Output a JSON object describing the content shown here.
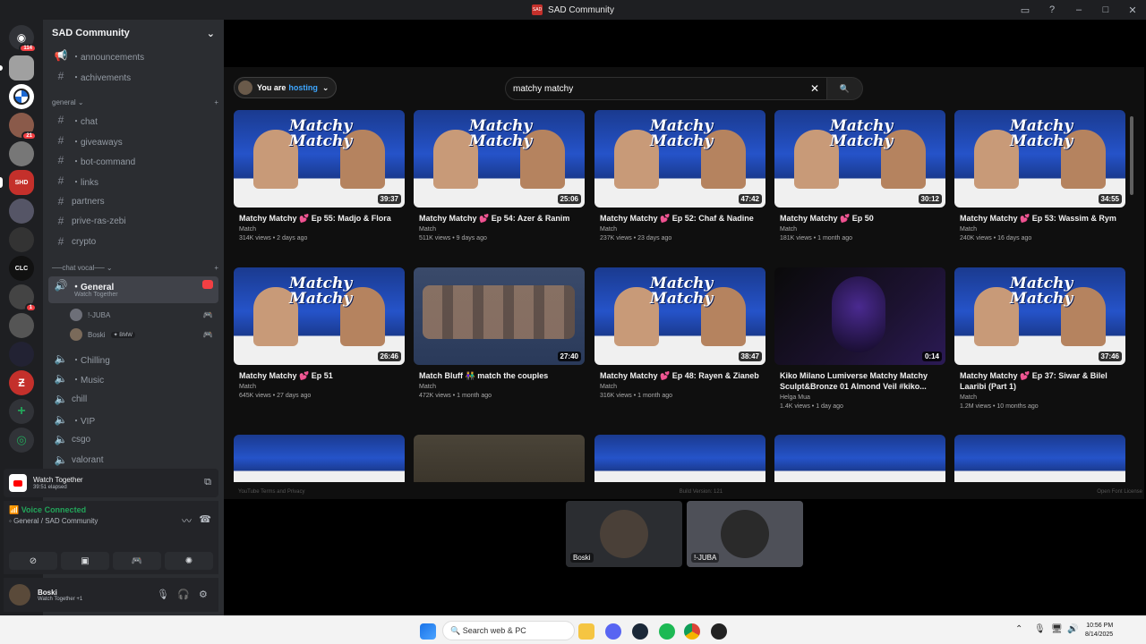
{
  "window": {
    "title": "SAD Community"
  },
  "rail": {
    "badge_top": "114",
    "badges": [
      "21",
      "1"
    ],
    "labels": [
      "SHD",
      "CLC"
    ]
  },
  "server": {
    "name": "SAD Community"
  },
  "channels": {
    "top": [
      {
        "icon": "megaphone-icon",
        "label": "・announcements"
      },
      {
        "icon": "hash-icon",
        "label": "・achivements"
      }
    ],
    "category_general": "general",
    "general": [
      {
        "icon": "hash-icon",
        "label": "・chat"
      },
      {
        "icon": "hash-icon",
        "label": "・giveaways"
      },
      {
        "icon": "hash-icon",
        "label": "・bot-command"
      },
      {
        "icon": "hash-icon",
        "label": "・links"
      },
      {
        "icon": "hash-icon",
        "label": "partners"
      },
      {
        "icon": "hash-icon",
        "label": "prive-ras-zebi"
      },
      {
        "icon": "hash-icon",
        "label": "crypto"
      }
    ],
    "category_voice": "──chat vocal──",
    "voice_active": {
      "label": "・General",
      "sub": "Watch Together"
    },
    "voice_users": [
      {
        "name": "!-JUBA",
        "tag": ""
      },
      {
        "name": "Boski",
        "tag": "BMW"
      }
    ],
    "voice": [
      {
        "label": "・Chilling"
      },
      {
        "label": "・Music"
      },
      {
        "label": "chill"
      },
      {
        "label": "・VIP"
      },
      {
        "label": "csgo"
      },
      {
        "label": "valorant"
      }
    ]
  },
  "activity": {
    "title": "Watch Together",
    "elapsed": "39:51 elapsed"
  },
  "voice_status": {
    "title": "Voice Connected",
    "channel": "General / SAD Community"
  },
  "user": {
    "name": "Boski",
    "status": "Watch Together +1"
  },
  "youtube": {
    "host_prefix": "You are",
    "host_word": "hosting",
    "search_value": "matchy matchy",
    "videos": [
      {
        "title": "Matchy Matchy 💕 Ep 55: Madjo & Flora",
        "channel": "Match",
        "meta": "314K views • 2 days ago",
        "duration": "39:37",
        "style": "studio"
      },
      {
        "title": "Matchy Matchy 💕 Ep 54: Azer & Ranim",
        "channel": "Match",
        "meta": "511K views • 9 days ago",
        "duration": "25:06",
        "style": "studio"
      },
      {
        "title": "Matchy Matchy 💕 Ep 52: Chaf & Nadine",
        "channel": "Match",
        "meta": "237K views • 23 days ago",
        "duration": "47:42",
        "style": "studio"
      },
      {
        "title": "Matchy Matchy 💕 Ep 50",
        "channel": "Match",
        "meta": "181K views • 1 month ago",
        "duration": "30:12",
        "style": "studio"
      },
      {
        "title": "Matchy Matchy 💕 Ep 53: Wassim & Rym",
        "channel": "Match",
        "meta": "240K views • 16 days ago",
        "duration": "34:55",
        "style": "studio"
      },
      {
        "title": "Matchy Matchy 💕 Ep 51",
        "channel": "Match",
        "meta": "645K views • 27 days ago",
        "duration": "26:46",
        "style": "studio"
      },
      {
        "title": "Match Bluff 👫 match the couples",
        "channel": "Match",
        "meta": "472K views • 1 month ago",
        "duration": "27:40",
        "style": "bluff"
      },
      {
        "title": "Matchy Matchy 💕 Ep 48: Rayen & Zianeb",
        "channel": "Match",
        "meta": "316K views • 1 month ago",
        "duration": "38:47",
        "style": "studio"
      },
      {
        "title": "Kiko Milano Lumiverse Matchy Matchy Sculpt&Bronze 01 Almond Veil #kiko...",
        "channel": "Helga Mua",
        "meta": "1.4K views • 1 day ago",
        "duration": "0:14",
        "style": "dark"
      },
      {
        "title": "Matchy Matchy 💕 Ep 37: Siwar & Bilel Laaribi (Part 1)",
        "channel": "Match",
        "meta": "1.2M views • 10 months ago",
        "duration": "37:46",
        "style": "studio"
      }
    ],
    "footer": {
      "left": "YouTube Terms and Privacy",
      "center": "Build Version: 121",
      "right": "Open Font License"
    }
  },
  "participants": [
    {
      "name": "Boski"
    },
    {
      "name": "!-JUBA"
    }
  ],
  "taskbar": {
    "search": "Search web & PC",
    "time": "10:56 PM",
    "date": "8/14/2025"
  }
}
